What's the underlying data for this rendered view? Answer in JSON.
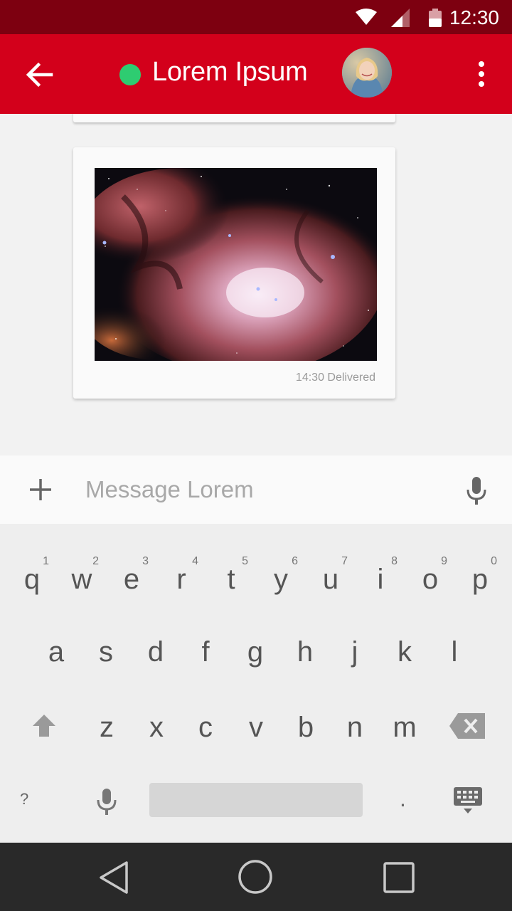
{
  "status_bar": {
    "time": "12:30",
    "icons": [
      "wifi-icon",
      "signal-icon",
      "battery-icon"
    ]
  },
  "app_bar": {
    "title": "Lorem Ipsum",
    "presence": "online",
    "colors": {
      "bar": "#d3001b",
      "status_bar": "#7d0010",
      "presence": "#2ecc71"
    }
  },
  "messages": [
    {
      "type": "image",
      "image_subject": "nebula",
      "time": "14:30",
      "status": "Delivered",
      "meta": "14:30 Delivered"
    }
  ],
  "composer": {
    "placeholder": "Message Lorem"
  },
  "keyboard": {
    "rows": [
      [
        "q",
        "w",
        "e",
        "r",
        "t",
        "y",
        "u",
        "i",
        "o",
        "p"
      ],
      [
        "a",
        "s",
        "d",
        "f",
        "g",
        "h",
        "j",
        "k",
        "l"
      ],
      [
        "z",
        "x",
        "c",
        "v",
        "b",
        "n",
        "m"
      ]
    ],
    "number_hints": [
      "1",
      "2",
      "3",
      "4",
      "5",
      "6",
      "7",
      "8",
      "9",
      "0"
    ],
    "symbols_key": "?",
    "period_key": "."
  },
  "nav_bar": {
    "icons": [
      "back-triangle-icon",
      "home-circle-icon",
      "recents-square-icon"
    ]
  }
}
